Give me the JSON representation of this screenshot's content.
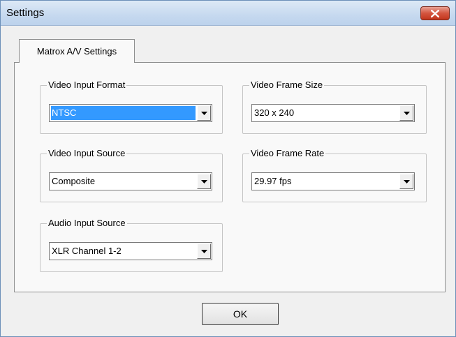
{
  "window": {
    "title": "Settings",
    "close_icon": "close-x-icon",
    "close_color": "#c7402a"
  },
  "tabs": [
    {
      "label": "Matrox A/V Settings",
      "active": true
    }
  ],
  "groups": {
    "video_input_format": {
      "label": "Video Input Format",
      "value": "NTSC",
      "selected": true
    },
    "video_frame_size": {
      "label": "Video Frame Size",
      "value": "320 x 240"
    },
    "video_input_source": {
      "label": "Video Input Source",
      "value": "Composite"
    },
    "video_frame_rate": {
      "label": "Video Frame Rate",
      "value": "29.97 fps"
    },
    "audio_input_source": {
      "label": "Audio Input Source",
      "value": "XLR Channel 1-2"
    }
  },
  "buttons": {
    "ok_label": "OK"
  },
  "colors": {
    "selection": "#3399ff",
    "dialog_bg": "#f0f0f0",
    "titlebar": "#c6d9ef"
  }
}
